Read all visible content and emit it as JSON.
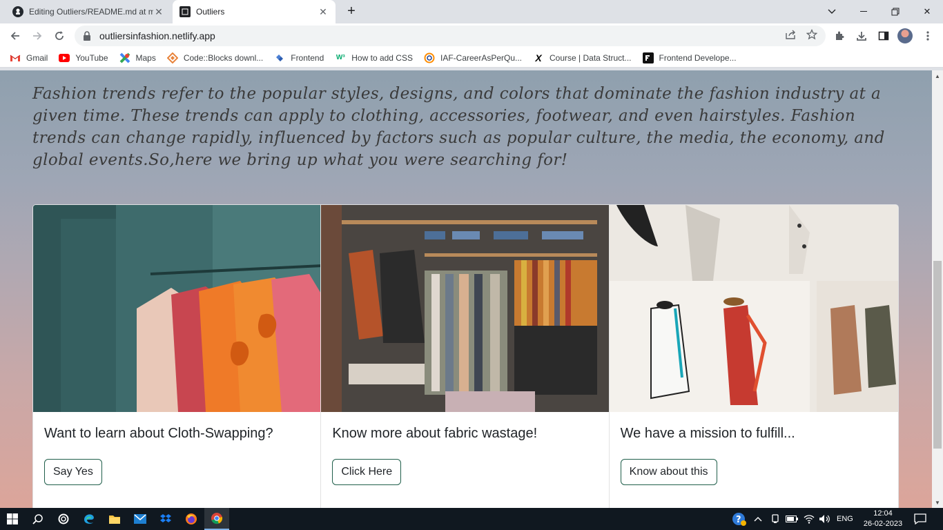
{
  "browser": {
    "tabs": [
      {
        "title": "Editing Outliers/README.md at m",
        "icon": "github-icon",
        "active": false
      },
      {
        "title": "Outliers",
        "icon": "outliers-favicon",
        "active": true
      }
    ],
    "url": "outliersinfashion.netlify.app",
    "bookmarks": [
      {
        "label": "Gmail",
        "icon": "gmail-icon"
      },
      {
        "label": "YouTube",
        "icon": "youtube-icon"
      },
      {
        "label": "Maps",
        "icon": "maps-icon"
      },
      {
        "label": "Code::Blocks downl...",
        "icon": "codeblocks-icon"
      },
      {
        "label": "Frontend",
        "icon": "frontend-icon"
      },
      {
        "label": "How to add CSS",
        "icon": "w3schools-icon"
      },
      {
        "label": "IAF-CareerAsPerQu...",
        "icon": "iaf-icon"
      },
      {
        "label": "Course | Data Struct...",
        "icon": "x-icon"
      },
      {
        "label": "Frontend Develope...",
        "icon": "frontend-dev-icon"
      }
    ]
  },
  "page": {
    "intro": "Fashion trends refer to the popular styles, designs, and colors that dominate the fashion industry at a given time. These trends can apply to clothing, accessories, footwear, and even hairstyles. Fashion trends can change rapidly, influenced by factors such as popular culture, the media, the economy, and global events.So,here we bring up what you were searching for!",
    "cards": [
      {
        "title": "Want to learn about Cloth-Swapping?",
        "button": "Say Yes"
      },
      {
        "title": "Know more about fabric wastage!",
        "button": "Click Here"
      },
      {
        "title": "We have a mission to fulfill...",
        "button": "Know about this"
      }
    ]
  },
  "taskbar": {
    "language": "ENG",
    "time": "12:04",
    "date": "26-02-2023"
  },
  "colors": {
    "button_border": "#1f5e4a",
    "taskbar_bg": "#101820"
  }
}
